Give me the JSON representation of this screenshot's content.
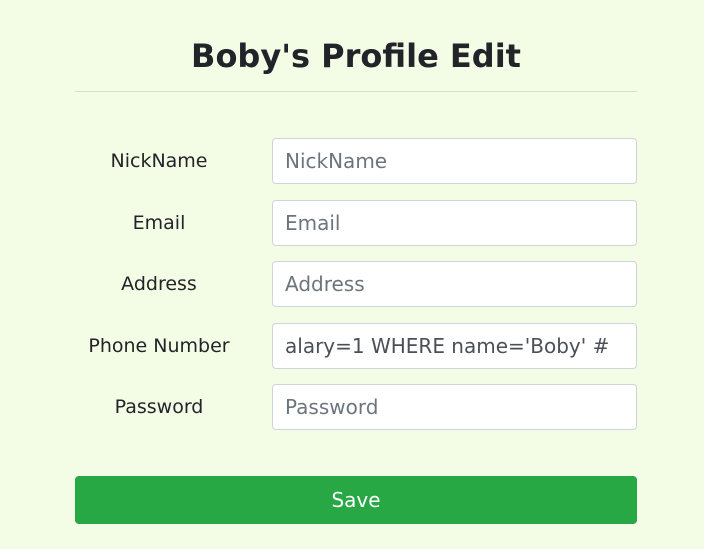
{
  "page": {
    "title": "Boby's Profile Edit"
  },
  "form": {
    "fields": [
      {
        "label": "NickName",
        "value": "",
        "placeholder": "NickName"
      },
      {
        "label": "Email",
        "value": "",
        "placeholder": "Email"
      },
      {
        "label": "Address",
        "value": "",
        "placeholder": "Address"
      },
      {
        "label": "Phone Number",
        "value": "alary=1 WHERE name='Boby' #",
        "placeholder": ""
      },
      {
        "label": "Password",
        "value": "",
        "placeholder": "Password"
      }
    ],
    "save_label": "Save"
  },
  "colors": {
    "background": "#f3fce4",
    "save_button": "#28a745",
    "save_text": "#ffffff"
  }
}
